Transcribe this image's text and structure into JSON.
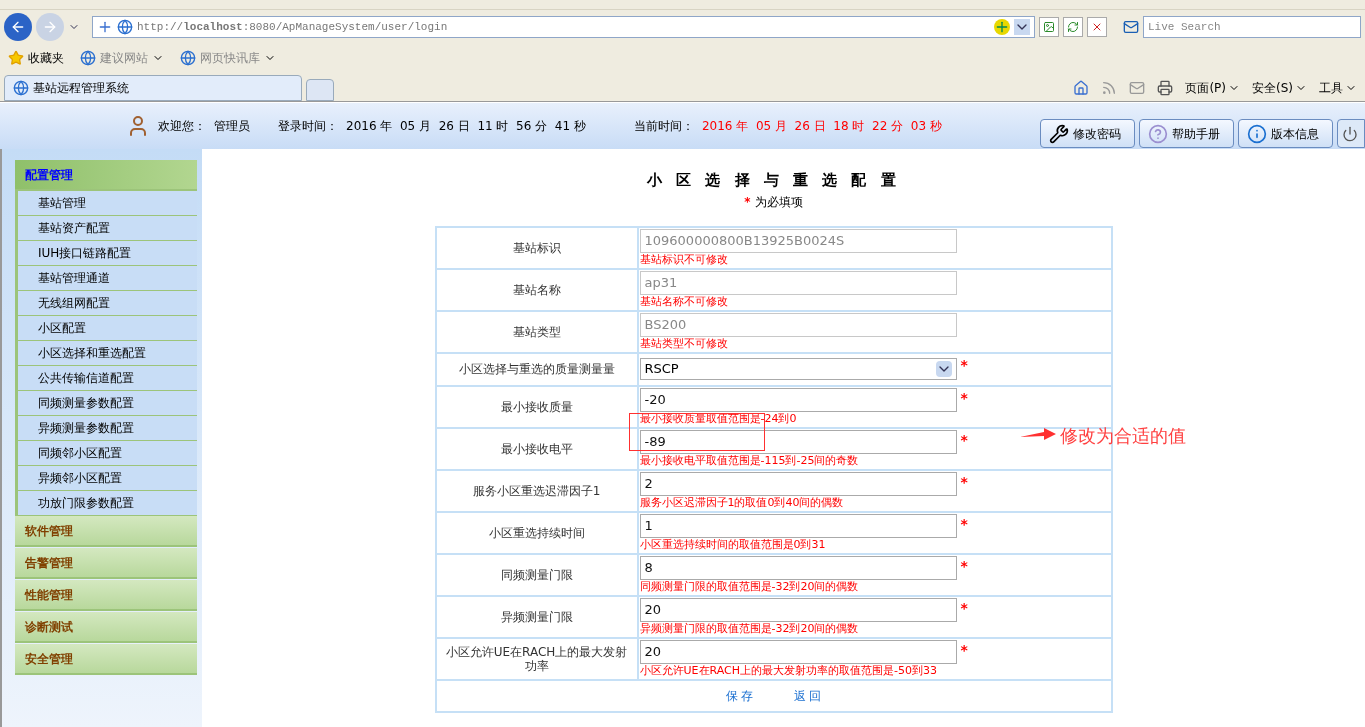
{
  "browser": {
    "address": "http://**localhost**:8080/ApManageSystem/user/login",
    "search_placeholder": "Live Search",
    "favorites": [
      {
        "label": "收藏夹",
        "kind": "star"
      },
      {
        "label": "建议网站",
        "kind": "page"
      },
      {
        "label": "网页快讯库",
        "kind": "page"
      }
    ],
    "tabs": [
      {
        "label": "基站远程管理系统",
        "selected": true
      }
    ],
    "commands": [
      "页面(P)",
      "安全(S)",
      "工具"
    ]
  },
  "header": {
    "welcome_label": "欢迎您：",
    "user": "管理员",
    "login_label": "登录时间：",
    "login_time": "2016 年  05 月  26 日  11 时  56 分  41 秒",
    "current_label": "当前时间：",
    "current_time": "2016 年  05 月  26 日  18 时  22 分  03 秒",
    "buttons": [
      {
        "label": "修改密码",
        "kind": "wrench"
      },
      {
        "label": "帮助手册",
        "kind": "help"
      },
      {
        "label": "版本信息",
        "kind": "info"
      }
    ]
  },
  "sidebar": {
    "groups": [
      {
        "label": "配置管理",
        "expanded": true,
        "items": [
          "基站管理",
          "基站资产配置",
          "IUH接口链路配置",
          "基站管理通道",
          "无线组网配置",
          "小区配置",
          "小区选择和重选配置",
          "公共传输信道配置",
          "同频测量参数配置",
          "异频测量参数配置",
          "同频邻小区配置",
          "异频邻小区配置",
          "功放门限参数配置"
        ]
      },
      {
        "label": "软件管理",
        "expanded": false
      },
      {
        "label": "告警管理",
        "expanded": false
      },
      {
        "label": "性能管理",
        "expanded": false
      },
      {
        "label": "诊断测试",
        "expanded": false
      },
      {
        "label": "安全管理",
        "expanded": false
      }
    ]
  },
  "form": {
    "title": "小 区 选 择 与 重 选 配 置",
    "required_note": "为必填项",
    "required_mark": "*",
    "rows": [
      {
        "label": "基站标识",
        "kind": "text",
        "value": "109600000800B13925B0024S",
        "readonly": true,
        "required": false,
        "hint": "基站标识不可修改"
      },
      {
        "label": "基站名称",
        "kind": "text",
        "value": "ap31",
        "readonly": true,
        "required": false,
        "hint": "基站名称不可修改"
      },
      {
        "label": "基站类型",
        "kind": "text",
        "value": "BS200",
        "readonly": true,
        "required": false,
        "hint": "基站类型不可修改"
      },
      {
        "label": "小区选择与重选的质量测量量",
        "kind": "select",
        "value": "RSCP",
        "readonly": false,
        "required": true
      },
      {
        "label": "最小接收质量",
        "kind": "text",
        "value": "-20",
        "readonly": false,
        "required": true,
        "hint": "最小接收质量取值范围是-24到0"
      },
      {
        "label": "最小接收电平",
        "kind": "text",
        "value": "-89",
        "readonly": false,
        "required": true,
        "hint": "最小接收电平取值范围是-115到-25间的奇数"
      },
      {
        "label": "服务小区重选迟滞因子1",
        "kind": "text",
        "value": "2",
        "readonly": false,
        "required": true,
        "hint": "服务小区迟滞因子1的取值0到40间的偶数"
      },
      {
        "label": "小区重选持续时间",
        "kind": "text",
        "value": "1",
        "readonly": false,
        "required": true,
        "hint": "小区重选持续时间的取值范围是0到31"
      },
      {
        "label": "同频测量门限",
        "kind": "text",
        "value": "8",
        "readonly": false,
        "required": true,
        "hint": "同频测量门限的取值范围是-32到20间的偶数"
      },
      {
        "label": "异频测量门限",
        "kind": "text",
        "value": "20",
        "readonly": false,
        "required": true,
        "hint": "异频测量门限的取值范围是-32到20间的偶数"
      },
      {
        "label": "小区允许UE在RACH上的最大发射功率",
        "kind": "text",
        "value": "20",
        "readonly": false,
        "required": true,
        "hint": "小区允许UE在RACH上的最大发射功率的取值范围是-50到33"
      }
    ],
    "actions": [
      "保 存",
      "返 回"
    ]
  },
  "annotation": {
    "text": "修改为合适的值"
  }
}
